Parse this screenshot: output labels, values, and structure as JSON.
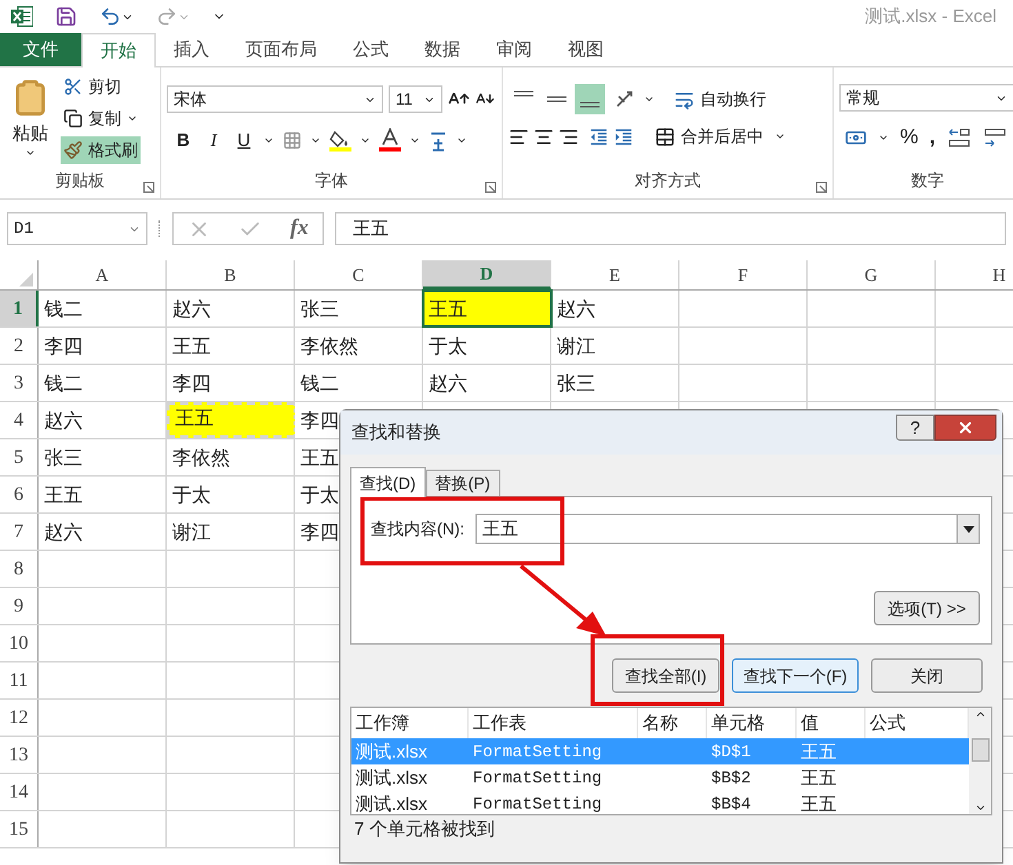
{
  "title": "测试.xlsx - Excel",
  "ribbon_tabs": [
    {
      "label": "文件",
      "kind": "file",
      "selected": false
    },
    {
      "label": "开始",
      "kind": "tab",
      "selected": true
    },
    {
      "label": "插入",
      "kind": "tab",
      "selected": false
    },
    {
      "label": "页面布局",
      "kind": "tab",
      "selected": false
    },
    {
      "label": "公式",
      "kind": "tab",
      "selected": false
    },
    {
      "label": "数据",
      "kind": "tab",
      "selected": false
    },
    {
      "label": "审阅",
      "kind": "tab",
      "selected": false
    },
    {
      "label": "视图",
      "kind": "tab",
      "selected": false
    }
  ],
  "clipboard": {
    "paste": "粘贴",
    "cut": "剪切",
    "copy": "复制",
    "format_painter": {
      "label": "格式刷",
      "on": true
    },
    "group": "剪贴板"
  },
  "font": {
    "name": "宋体",
    "size": "11",
    "bold": "B",
    "italic": "I",
    "underline": "U",
    "group": "字体"
  },
  "alignment": {
    "vertical": [
      {
        "selected": false
      },
      {
        "selected": false
      },
      {
        "selected": true
      }
    ],
    "wrap": "自动换行",
    "merge": "合并后居中",
    "group": "对齐方式"
  },
  "number": {
    "format": "常规",
    "percent": "%",
    "comma": ",",
    "group": "数字"
  },
  "formula_bar": {
    "name_box": "D1",
    "fx": "fx",
    "value": "王五"
  },
  "grid": {
    "columns": [
      {
        "label": "A",
        "selected": false
      },
      {
        "label": "B",
        "selected": false
      },
      {
        "label": "C",
        "selected": false
      },
      {
        "label": "D",
        "selected": true
      },
      {
        "label": "E",
        "selected": false
      },
      {
        "label": "F",
        "selected": false
      },
      {
        "label": "G",
        "selected": false
      },
      {
        "label": "H",
        "selected": false
      }
    ],
    "rows": [
      {
        "label": "1",
        "selected": true,
        "cells": [
          {
            "text": "钱二",
            "highlighted": false,
            "active": false,
            "copied": false
          },
          {
            "text": "赵六",
            "highlighted": false,
            "active": false,
            "copied": false
          },
          {
            "text": "张三",
            "highlighted": false,
            "active": false,
            "copied": false
          },
          {
            "text": "王五",
            "highlighted": true,
            "active": true,
            "copied": false
          },
          {
            "text": "赵六",
            "highlighted": false,
            "active": false,
            "copied": false
          }
        ]
      },
      {
        "label": "2",
        "selected": false,
        "cells": [
          {
            "text": "李四",
            "highlighted": false,
            "active": false,
            "copied": false
          },
          {
            "text": "王五",
            "highlighted": false,
            "active": false,
            "copied": false
          },
          {
            "text": "李依然",
            "highlighted": false,
            "active": false,
            "copied": false
          },
          {
            "text": "于太",
            "highlighted": false,
            "active": false,
            "copied": false
          },
          {
            "text": "谢江",
            "highlighted": false,
            "active": false,
            "copied": false
          }
        ]
      },
      {
        "label": "3",
        "selected": false,
        "cells": [
          {
            "text": "钱二",
            "highlighted": false,
            "active": false,
            "copied": false
          },
          {
            "text": "李四",
            "highlighted": false,
            "active": false,
            "copied": false
          },
          {
            "text": "钱二",
            "highlighted": false,
            "active": false,
            "copied": false
          },
          {
            "text": "赵六",
            "highlighted": false,
            "active": false,
            "copied": false
          },
          {
            "text": "张三",
            "highlighted": false,
            "active": false,
            "copied": false
          }
        ]
      },
      {
        "label": "4",
        "selected": false,
        "cells": [
          {
            "text": "赵六",
            "highlighted": false,
            "active": false,
            "copied": false
          },
          {
            "text": "王五",
            "highlighted": true,
            "active": false,
            "copied": true
          },
          {
            "text": "李四",
            "highlighted": false,
            "active": false,
            "copied": false
          }
        ]
      },
      {
        "label": "5",
        "selected": false,
        "cells": [
          {
            "text": "张三",
            "highlighted": false,
            "active": false,
            "copied": false
          },
          {
            "text": "李依然",
            "highlighted": false,
            "active": false,
            "copied": false
          },
          {
            "text": "王五",
            "highlighted": false,
            "active": false,
            "copied": false
          }
        ]
      },
      {
        "label": "6",
        "selected": false,
        "cells": [
          {
            "text": "王五",
            "highlighted": false,
            "active": false,
            "copied": false
          },
          {
            "text": "于太",
            "highlighted": false,
            "active": false,
            "copied": false
          },
          {
            "text": "于太",
            "highlighted": false,
            "active": false,
            "copied": false
          }
        ]
      },
      {
        "label": "7",
        "selected": false,
        "cells": [
          {
            "text": "赵六",
            "highlighted": false,
            "active": false,
            "copied": false
          },
          {
            "text": "谢江",
            "highlighted": false,
            "active": false,
            "copied": false
          },
          {
            "text": "李四",
            "highlighted": false,
            "active": false,
            "copied": false
          }
        ]
      },
      {
        "label": "8",
        "selected": false,
        "cells": []
      },
      {
        "label": "9",
        "selected": false,
        "cells": []
      },
      {
        "label": "10",
        "selected": false,
        "cells": []
      },
      {
        "label": "11",
        "selected": false,
        "cells": []
      },
      {
        "label": "12",
        "selected": false,
        "cells": []
      },
      {
        "label": "13",
        "selected": false,
        "cells": []
      },
      {
        "label": "14",
        "selected": false,
        "cells": []
      },
      {
        "label": "15",
        "selected": false,
        "cells": []
      }
    ]
  },
  "dialog": {
    "title": "查找和替换",
    "help": "?",
    "tabs": [
      {
        "label": "查找(D)",
        "selected": true
      },
      {
        "label": "替换(P)",
        "selected": false
      }
    ],
    "find_label": "查找内容(N):",
    "find_value": "王五",
    "options": "选项(T) >>",
    "buttons": [
      {
        "label": "查找全部(I)",
        "kind": "normal"
      },
      {
        "label": "查找下一个(F)",
        "kind": "default"
      },
      {
        "label": "关闭",
        "kind": "normal"
      }
    ],
    "result_columns": [
      "工作簿",
      "工作表",
      "名称",
      "单元格",
      "值",
      "公式"
    ],
    "results": [
      {
        "workbook": "测试.xlsx",
        "sheet": "FormatSetting",
        "cell": "$D$1",
        "value": "王五",
        "selected": true
      },
      {
        "workbook": "测试.xlsx",
        "sheet": "FormatSetting",
        "cell": "$B$2",
        "value": "王五",
        "selected": false
      },
      {
        "workbook": "测试.xlsx",
        "sheet": "FormatSetting",
        "cell": "$B$4",
        "value": "王五",
        "selected": false
      }
    ],
    "status": "7 个单元格被找到"
  }
}
